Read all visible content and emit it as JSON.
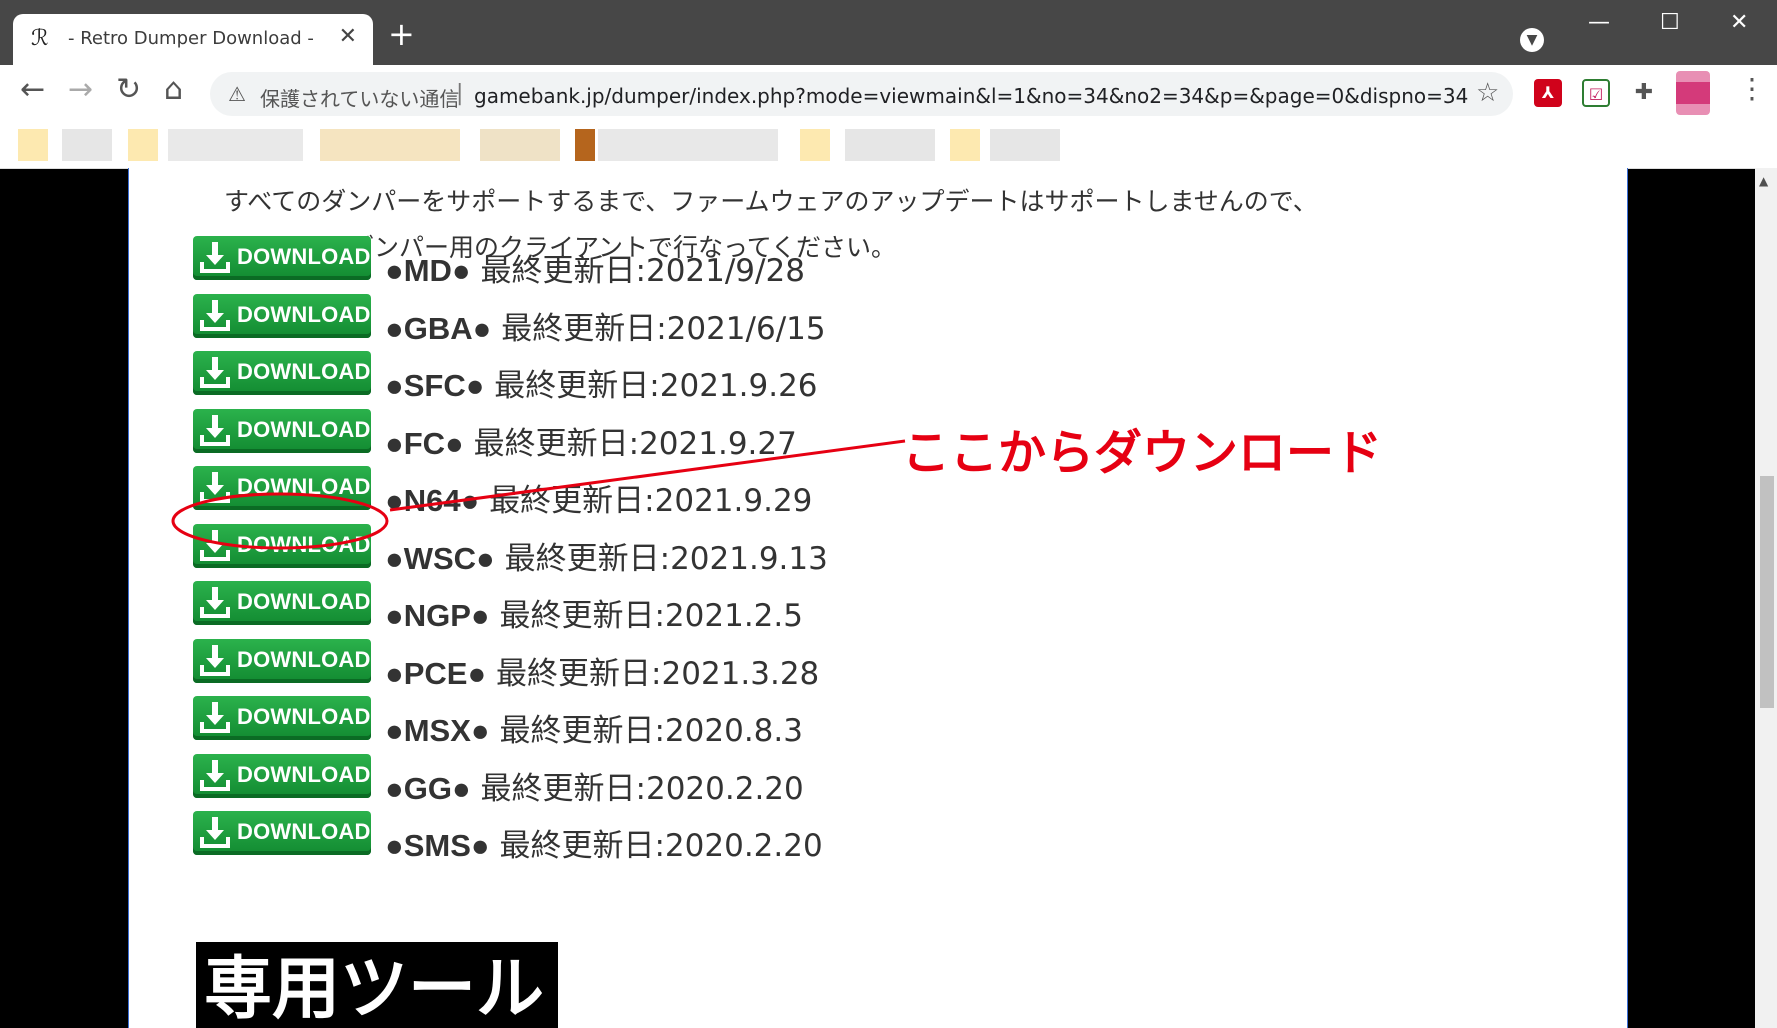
{
  "tab": {
    "title": "- Retro Dumper Download -",
    "favicon": "ℛ",
    "close": "✕"
  },
  "newtab_label": "+",
  "window_controls": {
    "minimize": "—",
    "maximize": "☐",
    "close": "✕"
  },
  "address_bar": {
    "security_text": "保護されていない通信",
    "url_separator": "|",
    "url": "gamebank.jp/dumper/index.php?mode=viewmain&l=1&no=34&no2=34&p=&page=0&dispno=34"
  },
  "nav": {
    "back": "←",
    "forward": "→",
    "reload": "↻",
    "home": "⌂",
    "star": "☆",
    "menu": "⋮"
  },
  "extensions": {
    "pdf": "⅄",
    "save": "☑",
    "puzzle": "✚"
  },
  "intro": {
    "line1": "すべてのダンパーをサポートするまで、ファームウェアのアップデートはサポートしませんので、",
    "line2": "それぞれのダンパー用のクライアントで行なってください。"
  },
  "download_button_label": "DOWNLOAD",
  "downloads": [
    {
      "name": "●MD●",
      "date_label": " 最終更新日:2021/9/28"
    },
    {
      "name": "●GBA●",
      "date_label": " 最終更新日:2021/6/15"
    },
    {
      "name": "●SFC●",
      "date_label": " 最終更新日:2021.9.26"
    },
    {
      "name": "●FC●",
      "date_label": " 最終更新日:2021.9.27"
    },
    {
      "name": "●N64●",
      "date_label": " 最終更新日:2021.9.29"
    },
    {
      "name": "●WSC●",
      "date_label": " 最終更新日:2021.9.13"
    },
    {
      "name": "●NGP●",
      "date_label": " 最終更新日:2021.2.5"
    },
    {
      "name": "●PCE●",
      "date_label": " 最終更新日:2021.3.28"
    },
    {
      "name": "●MSX●",
      "date_label": " 最終更新日:2020.8.3"
    },
    {
      "name": "●GG●",
      "date_label": " 最終更新日:2020.2.20"
    },
    {
      "name": "●SMS●",
      "date_label": " 最終更新日:2020.2.20"
    }
  ],
  "section_heading": "専用ツール",
  "annotation": {
    "text": "ここからダウンロード",
    "color": "#e60012",
    "highlighted_item": "●N64●"
  },
  "colors": {
    "download_green": "#1e9e3e",
    "titlebar": "#474747"
  }
}
